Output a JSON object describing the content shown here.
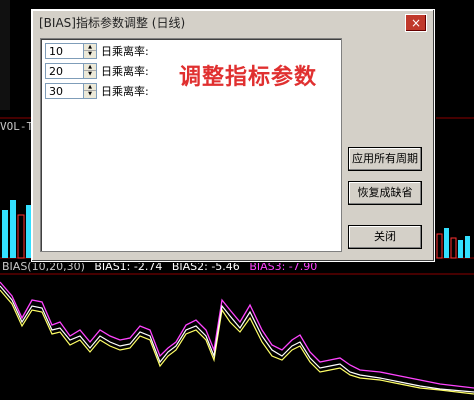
{
  "chart": {
    "vol_label": "VOL-T",
    "bias_legend": {
      "title": "BIAS(10,20,30)",
      "bias1": "BIAS1: -2.74",
      "bias2": "BIAS2: -5.46",
      "bias3": "BIAS3: -7.90"
    },
    "colors": {
      "bias1": "#ffffff",
      "bias2": "#ffff66",
      "bias3": "#ff44ff",
      "bars_cyan": "#33e0ff",
      "bars_red": "#ff3030"
    }
  },
  "dialog": {
    "title": "[BIAS]指标参数调整 (日线)",
    "close_label": "×",
    "caption": "调整指标参数",
    "params": [
      {
        "value": "10",
        "label": "日乘离率:"
      },
      {
        "value": "20",
        "label": "日乘离率:"
      },
      {
        "value": "30",
        "label": "日乘离率:"
      }
    ],
    "buttons": {
      "apply_all": "应用所有周期",
      "restore_default": "恢复成缺省",
      "close": "关闭"
    }
  }
}
